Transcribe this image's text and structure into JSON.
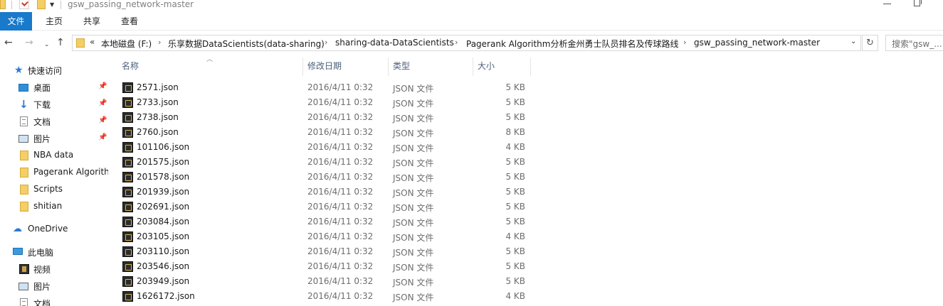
{
  "window": {
    "title": "gsw_passing_network-master"
  },
  "ribbon": {
    "tabs": [
      "文件",
      "主页",
      "共享",
      "查看"
    ]
  },
  "address": {
    "overflow": "«",
    "crumbs": [
      "本地磁盘 (F:)",
      "乐享数据DataScientists(data-sharing)",
      "sharing-data-DataScientists",
      "Pagerank Algorithm分析金州勇士队员排名及传球路线",
      "gsw_passing_network-master"
    ],
    "separator": "›"
  },
  "search": {
    "placeholder": "搜索\"gsw_..."
  },
  "sidebar": {
    "items": [
      {
        "label": "快速访问",
        "icon": "star-icon"
      },
      {
        "label": "桌面",
        "icon": "desktop-icon",
        "pinned": true
      },
      {
        "label": "下载",
        "icon": "download-icon",
        "pinned": true
      },
      {
        "label": "文档",
        "icon": "document-icon",
        "pinned": true
      },
      {
        "label": "图片",
        "icon": "picture-icon",
        "pinned": true
      },
      {
        "label": "NBA data",
        "icon": "folder-icon"
      },
      {
        "label": "Pagerank Algorithm",
        "icon": "folder-icon"
      },
      {
        "label": "Scripts",
        "icon": "folder-icon"
      },
      {
        "label": "shitian",
        "icon": "folder-icon"
      },
      {
        "label": "OneDrive",
        "icon": "cloud-icon"
      },
      {
        "label": "此电脑",
        "icon": "computer-icon"
      },
      {
        "label": "视频",
        "icon": "video-icon"
      },
      {
        "label": "图片",
        "icon": "picture-icon"
      },
      {
        "label": "文档",
        "icon": "document-icon"
      }
    ]
  },
  "columns": {
    "name": "名称",
    "date": "修改日期",
    "type": "类型",
    "size": "大小"
  },
  "files": [
    {
      "name": "2571.json",
      "date": "2016/4/11 0:32",
      "type": "JSON 文件",
      "size": "5 KB"
    },
    {
      "name": "2733.json",
      "date": "2016/4/11 0:32",
      "type": "JSON 文件",
      "size": "5 KB"
    },
    {
      "name": "2738.json",
      "date": "2016/4/11 0:32",
      "type": "JSON 文件",
      "size": "5 KB"
    },
    {
      "name": "2760.json",
      "date": "2016/4/11 0:32",
      "type": "JSON 文件",
      "size": "8 KB"
    },
    {
      "name": "101106.json",
      "date": "2016/4/11 0:32",
      "type": "JSON 文件",
      "size": "4 KB"
    },
    {
      "name": "201575.json",
      "date": "2016/4/11 0:32",
      "type": "JSON 文件",
      "size": "5 KB"
    },
    {
      "name": "201578.json",
      "date": "2016/4/11 0:32",
      "type": "JSON 文件",
      "size": "5 KB"
    },
    {
      "name": "201939.json",
      "date": "2016/4/11 0:32",
      "type": "JSON 文件",
      "size": "5 KB"
    },
    {
      "name": "202691.json",
      "date": "2016/4/11 0:32",
      "type": "JSON 文件",
      "size": "5 KB"
    },
    {
      "name": "203084.json",
      "date": "2016/4/11 0:32",
      "type": "JSON 文件",
      "size": "5 KB"
    },
    {
      "name": "203105.json",
      "date": "2016/4/11 0:32",
      "type": "JSON 文件",
      "size": "4 KB"
    },
    {
      "name": "203110.json",
      "date": "2016/4/11 0:32",
      "type": "JSON 文件",
      "size": "5 KB"
    },
    {
      "name": "203546.json",
      "date": "2016/4/11 0:32",
      "type": "JSON 文件",
      "size": "5 KB"
    },
    {
      "name": "203949.json",
      "date": "2016/4/11 0:32",
      "type": "JSON 文件",
      "size": "5 KB"
    },
    {
      "name": "1626172.json",
      "date": "2016/4/11 0:32",
      "type": "JSON 文件",
      "size": "4 KB"
    }
  ],
  "colors": {
    "accent": "#1979ca",
    "folder": "#f3cf66",
    "header_text": "#4c607a"
  }
}
